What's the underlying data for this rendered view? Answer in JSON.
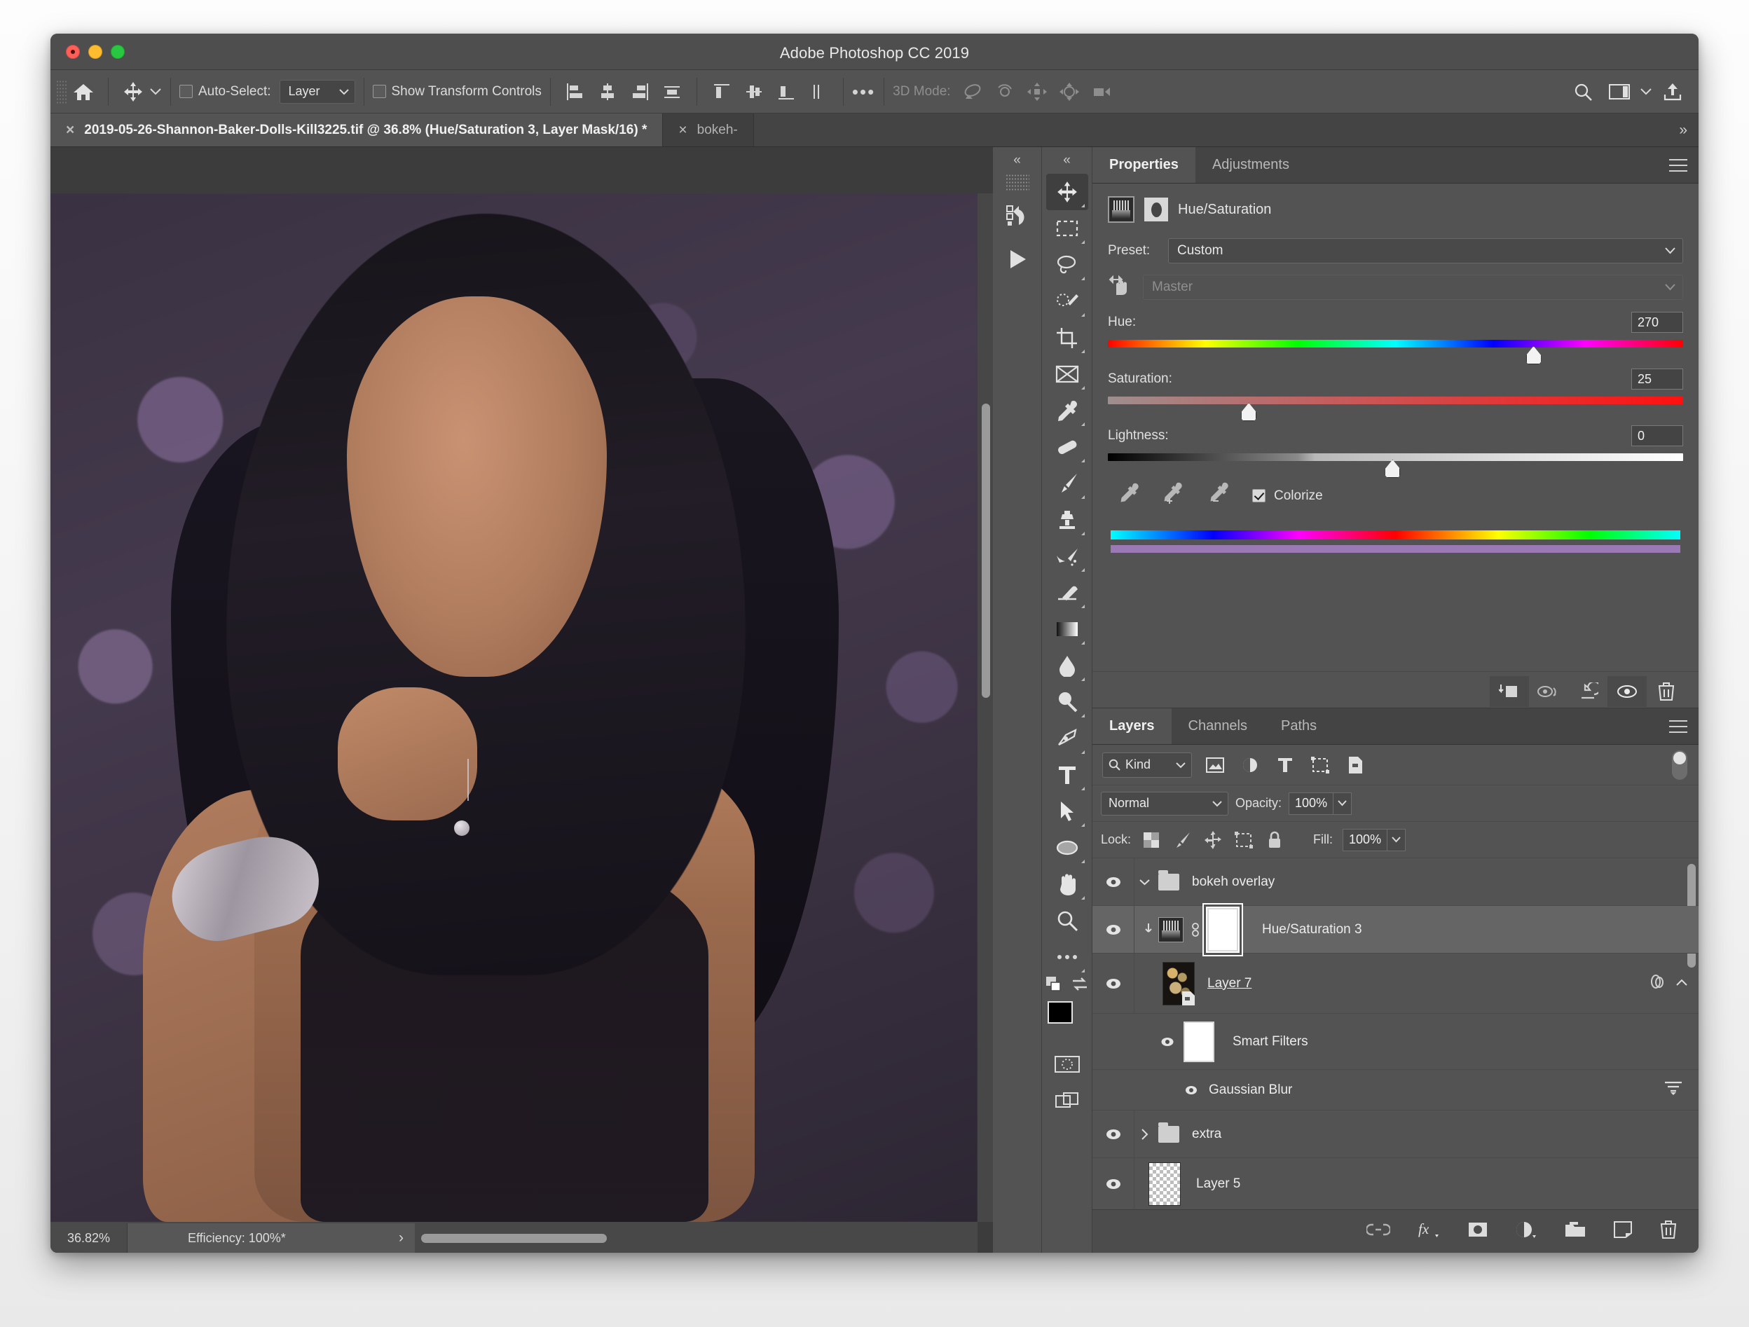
{
  "app": {
    "title": "Adobe Photoshop CC 2019"
  },
  "options_bar": {
    "home_icon": "home-icon",
    "move_tool_icon": "move-tool-icon",
    "auto_select_label": "Auto-Select:",
    "auto_select_checked": false,
    "auto_select_value": "Layer",
    "show_transform_label": "Show Transform Controls",
    "show_transform_checked": false,
    "more_label": "•••",
    "mode_3d_label": "3D Mode:",
    "search_icon": "search-icon",
    "workspace_icon": "workspace-icon",
    "share_icon": "share-icon"
  },
  "tabs": {
    "active": "2019-05-26-Shannon-Baker-Dolls-Kill3225.tif @ 36.8% (Hue/Saturation 3, Layer Mask/16) *",
    "second": "bokeh-",
    "overflow": "»"
  },
  "status": {
    "zoom": "36.82%",
    "efficiency": "Efficiency: 100%*",
    "expand_arrow": "›"
  },
  "properties": {
    "tab_properties": "Properties",
    "tab_adjustments": "Adjustments",
    "adjustment_name": "Hue/Saturation",
    "preset_label": "Preset:",
    "preset_value": "Custom",
    "channel_value": "Master",
    "hue_label": "Hue:",
    "hue_value": "270",
    "saturation_label": "Saturation:",
    "saturation_value": "25",
    "lightness_label": "Lightness:",
    "lightness_value": "0",
    "colorize_label": "Colorize",
    "colorize_checked": true,
    "footer_icons": [
      "clip-to-layer-icon",
      "view-previous-state-icon",
      "reset-icon",
      "toggle-visibility-icon",
      "delete-icon"
    ],
    "range_color": "#9b79b5"
  },
  "layers": {
    "tab_layers": "Layers",
    "tab_channels": "Channels",
    "tab_paths": "Paths",
    "filter_kind": "Kind",
    "filter_icons": [
      "pixel-filter-icon",
      "adjustment-filter-icon",
      "type-filter-icon",
      "shape-filter-icon",
      "smart-object-filter-icon"
    ],
    "blend_mode": "Normal",
    "opacity_label": "Opacity:",
    "opacity_value": "100%",
    "lock_label": "Lock:",
    "lock_icons": [
      "lock-transparency-icon",
      "lock-pixels-icon",
      "lock-position-icon",
      "lock-artboard-icon",
      "lock-all-icon"
    ],
    "fill_label": "Fill:",
    "fill_value": "100%",
    "rows": [
      {
        "name": "bokeh overlay",
        "type": "group",
        "expanded": true,
        "visible": true,
        "selected": false
      },
      {
        "name": "Hue/Saturation 3",
        "type": "adjustment",
        "visible": true,
        "selected": true,
        "clipped": true
      },
      {
        "name": "Layer 7",
        "type": "smart-object",
        "visible": true,
        "selected": false
      },
      {
        "name": "Smart Filters",
        "type": "smart-filters",
        "visible": true,
        "selected": false
      },
      {
        "name": "Gaussian Blur",
        "type": "filter",
        "visible": true,
        "selected": false
      },
      {
        "name": "extra",
        "type": "group",
        "expanded": false,
        "visible": true,
        "selected": false
      },
      {
        "name": "Layer 5",
        "type": "pixel",
        "visible": true,
        "selected": false
      }
    ],
    "footer_icons": [
      "link-layers-icon",
      "layer-style-icon",
      "add-mask-icon",
      "new-adjustment-icon",
      "new-group-icon",
      "new-layer-icon",
      "delete-layer-icon"
    ]
  },
  "toolbox": {
    "collapse": "«",
    "tools": [
      "move-tool-icon",
      "marquee-tool-icon",
      "lasso-tool-icon",
      "quick-selection-tool-icon",
      "crop-tool-icon",
      "frame-tool-icon",
      "eyedropper-tool-icon",
      "healing-brush-tool-icon",
      "brush-tool-icon",
      "clone-stamp-tool-icon",
      "history-brush-tool-icon",
      "eraser-tool-icon",
      "gradient-tool-icon",
      "blur-tool-icon",
      "dodge-tool-icon",
      "pen-tool-icon",
      "type-tool-icon",
      "path-selection-tool-icon",
      "shape-tool-icon",
      "hand-tool-icon",
      "zoom-tool-icon",
      "more-tools-icon"
    ],
    "foreground_color": "#000000",
    "background_color": "#ffffff",
    "quick_mask_icon": "quick-mask-icon",
    "screen-mode_icon": "screen-mode-icon"
  },
  "dock_column": {
    "collapse": "«",
    "history_icon": "history-icon",
    "play_icon": "play-icon"
  }
}
